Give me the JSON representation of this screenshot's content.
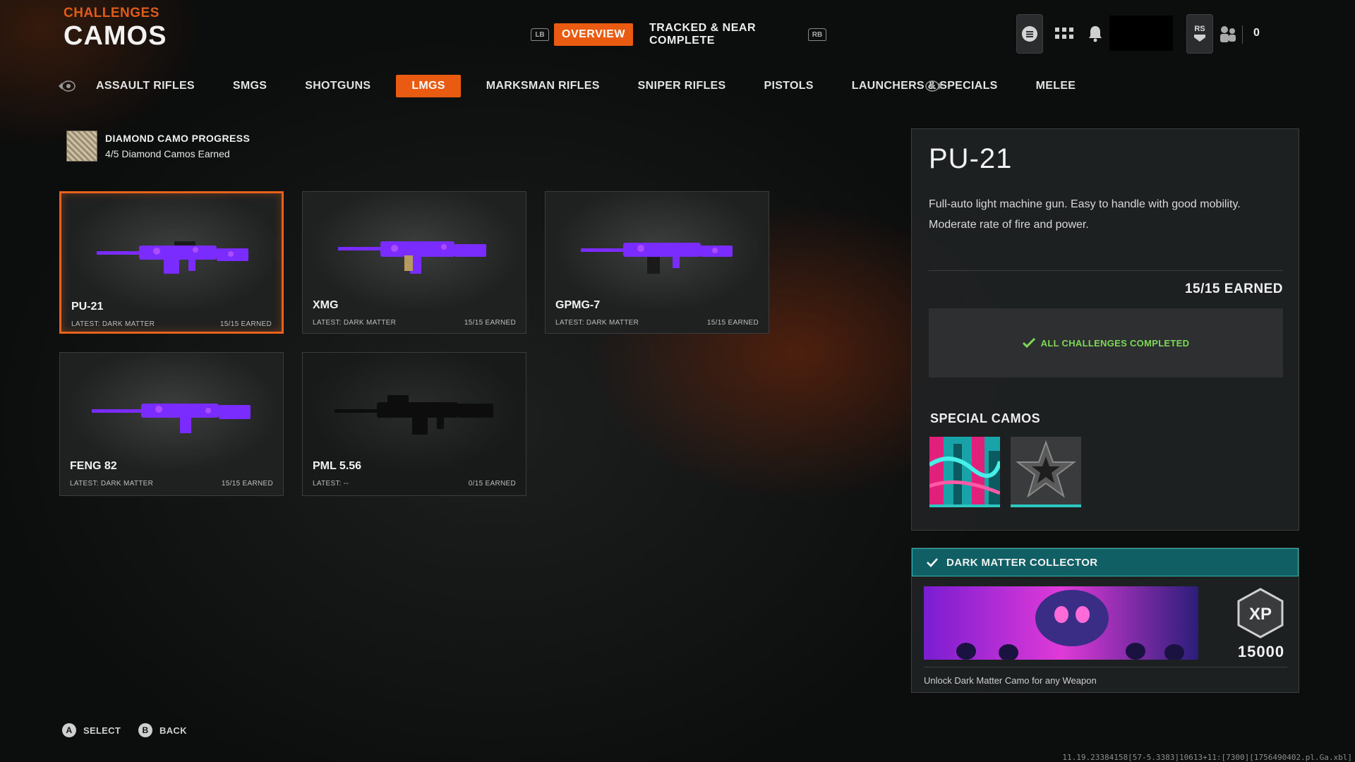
{
  "header": {
    "section": "CHALLENGES",
    "title": "CAMOS"
  },
  "top_tabs": {
    "left_bumper": "LB",
    "right_bumper": "RB",
    "overview": "OVERVIEW",
    "tracked": "TRACKED & NEAR COMPLETE"
  },
  "utility": {
    "party_count": "0",
    "right_stick": "RS"
  },
  "categories": {
    "assault": "ASSAULT RIFLES",
    "smgs": "SMGS",
    "shotguns": "SHOTGUNS",
    "lmgs": "LMGS",
    "marksman": "MARKSMAN RIFLES",
    "sniper": "SNIPER RIFLES",
    "pistols": "PISTOLS",
    "launchers": "LAUNCHERS & SPECIALS",
    "melee": "MELEE",
    "selected": "LMGS"
  },
  "diamond": {
    "title": "DIAMOND CAMO PROGRESS",
    "subtitle": "4/5 Diamond Camos Earned"
  },
  "weapons": [
    {
      "name": "PU-21",
      "latest": "LATEST: DARK MATTER",
      "earned": "15/15 EARNED"
    },
    {
      "name": "XMG",
      "latest": "LATEST: DARK MATTER",
      "earned": "15/15 EARNED"
    },
    {
      "name": "GPMG-7",
      "latest": "LATEST: DARK MATTER",
      "earned": "15/15 EARNED"
    },
    {
      "name": "FENG 82",
      "latest": "LATEST: DARK MATTER",
      "earned": "15/15 EARNED"
    },
    {
      "name": "PML 5.56",
      "latest": "LATEST: --",
      "earned": "0/15 EARNED"
    }
  ],
  "detail": {
    "name": "PU-21",
    "description": "Full-auto light machine gun.  Easy to handle with good mobility. Moderate rate of fire and power.",
    "earned": "15/15 EARNED",
    "status": "ALL CHALLENGES COMPLETED",
    "special_title": "SPECIAL CAMOS"
  },
  "reward": {
    "title": "DARK MATTER COLLECTOR",
    "xp_badge": "XP",
    "xp": "15000",
    "description": "Unlock Dark Matter Camo for any Weapon"
  },
  "footer": {
    "select_key": "A",
    "select_label": "SELECT",
    "back_key": "B",
    "back_label": "BACK",
    "build": "11.19.23384158[57-5.3383]10613+11:[7300][1756490402.pl.Ga.xbl]"
  },
  "colors": {
    "accent": "#ea5b12",
    "complete_green": "#7ed957",
    "teal": "#0f5f64",
    "camo_purple": "#7a2cff"
  }
}
